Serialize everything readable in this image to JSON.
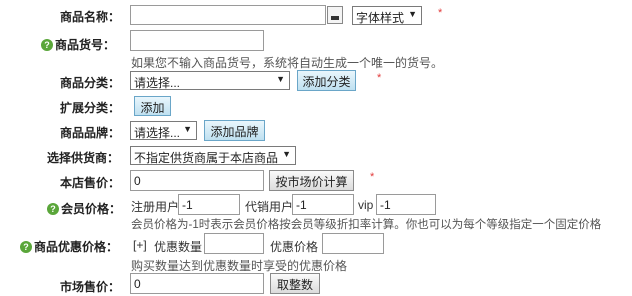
{
  "form": {
    "name": {
      "label": "商品名称：",
      "value": "",
      "font_style": "字体样式",
      "required": "*"
    },
    "sn": {
      "label": "商品货号：",
      "value": "",
      "hint": "如果您不输入商品货号，系统将自动生成一个唯一的货号。"
    },
    "category": {
      "label": "商品分类：",
      "selected": "请选择...",
      "add_button": "添加分类",
      "required": "*"
    },
    "ext_category": {
      "label": "扩展分类：",
      "add_button": "添加"
    },
    "brand": {
      "label": "商品品牌：",
      "selected": "请选择...",
      "add_button": "添加品牌"
    },
    "supplier": {
      "label": "选择供货商：",
      "selected": "不指定供货商属于本店商品"
    },
    "shop_price": {
      "label": "本店售价：",
      "value": "0",
      "calc_button": "按市场价计算",
      "required": "*"
    },
    "member_price": {
      "label": "会员价格：",
      "registered_label": "注册用户",
      "registered_value": "-1",
      "agent_label": "代销用户",
      "agent_value": "-1",
      "vip_label": "vip",
      "vip_value": "-1",
      "hint": "会员价格为-1时表示会员价格按会员等级折扣率计算。你也可以为每个等级指定一个固定价格"
    },
    "volume_price": {
      "label": "商品优惠价格：",
      "toggle": "[+]",
      "qty_label": "优惠数量",
      "qty_value": "",
      "price_label": "优惠价格",
      "price_value": "",
      "hint": "购买数量达到优惠数量时享受的优惠价格"
    },
    "market_price": {
      "label": "市场售价：",
      "value": "0",
      "round_button": "取整数"
    }
  },
  "colors": {
    "required_star": "#e23a3a",
    "help_icon": "#5aa63a",
    "blue_button": "#bfe0f0"
  },
  "icons": {
    "help": "question-circle-icon",
    "color_picker": "color-picker-icon",
    "dropdown": "triangle-down-icon"
  }
}
